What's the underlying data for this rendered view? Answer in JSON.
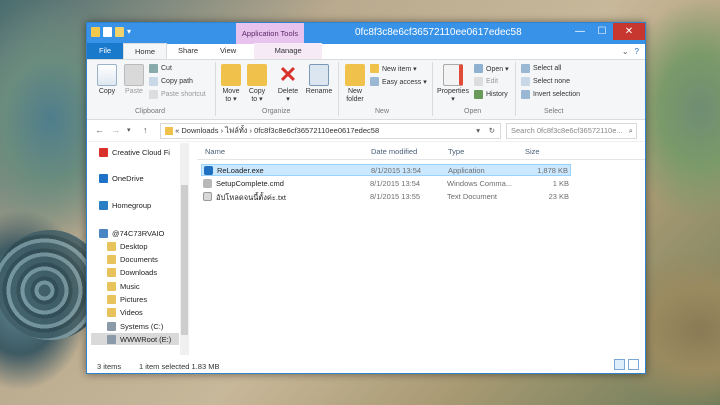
{
  "window": {
    "title": "0fc8f3c8e6cf36572110ee0617edec58",
    "context_tab": "Application Tools",
    "controls": {
      "minimize": "—",
      "maximize": "☐",
      "close": "✕"
    }
  },
  "tabs": {
    "file": "File",
    "home": "Home",
    "share": "Share",
    "view": "View",
    "manage": "Manage",
    "collapse": "⌄",
    "help": "?"
  },
  "ribbon": {
    "clipboard": {
      "copy": "Copy",
      "paste": "Paste",
      "cut": "Cut",
      "copy_path": "Copy path",
      "paste_shortcut": "Paste shortcut",
      "group": "Clipboard"
    },
    "organize": {
      "move_to_1": "Move",
      "move_to_2": "to ▾",
      "copy_to_1": "Copy",
      "copy_to_2": "to ▾",
      "delete_1": "Delete",
      "delete_2": "▾",
      "rename": "Rename",
      "group": "Organize"
    },
    "new": {
      "new_folder_1": "New",
      "new_folder_2": "folder",
      "new_item": "New item ▾",
      "easy_access": "Easy access ▾",
      "group": "New"
    },
    "open": {
      "properties_1": "Properties",
      "properties_2": "▾",
      "open": "Open ▾",
      "edit": "Edit",
      "history": "History",
      "group": "Open"
    },
    "select": {
      "select_all": "Select all",
      "select_none": "Select none",
      "invert_selection": "Invert selection",
      "group": "Select"
    }
  },
  "address": {
    "back": "←",
    "forward": "→",
    "dropdown": "▾",
    "up": "↑",
    "path_prefix": "«",
    "crumbs": [
      "Downloads",
      "ไฟล์ทั้ง",
      "0fc8f3c8e6cf36572110ee0617edec58"
    ],
    "separator": "›",
    "refresh": "↻",
    "search_placeholder": "Search 0fc8f3c8e6cf36572110e...",
    "search_icon": "⌕"
  },
  "nav_pane": {
    "items": [
      {
        "label": "Creative Cloud Fi",
        "icon": "creative-cloud-icon",
        "color": "#d9302a"
      },
      {
        "label": "OneDrive",
        "icon": "onedrive-icon",
        "color": "#1e73c8"
      },
      {
        "label": "Homegroup",
        "icon": "homegroup-icon",
        "color": "#2a7fc4"
      },
      {
        "label": "@74C73RVAIO",
        "icon": "computer-icon",
        "color": "#4a86c4"
      },
      {
        "label": "Desktop",
        "icon": "folder-icon",
        "color": "#e8c25a"
      },
      {
        "label": "Documents",
        "icon": "documents-icon",
        "color": "#e8c25a"
      },
      {
        "label": "Downloads",
        "icon": "downloads-icon",
        "color": "#e8c25a"
      },
      {
        "label": "Music",
        "icon": "music-icon",
        "color": "#e8c25a"
      },
      {
        "label": "Pictures",
        "icon": "pictures-icon",
        "color": "#e8c25a"
      },
      {
        "label": "Videos",
        "icon": "videos-icon",
        "color": "#e8c25a"
      },
      {
        "label": "Systems (C:)",
        "icon": "drive-icon",
        "color": "#8a9aa8"
      },
      {
        "label": "WWWRoot (E:)",
        "icon": "drive-icon",
        "color": "#8a9aa8"
      }
    ]
  },
  "columns": {
    "name": "Name",
    "date": "Date modified",
    "type": "Type",
    "size": "Size"
  },
  "files": [
    {
      "name": "ReLoader.exe",
      "date": "8/1/2015 13:54",
      "type": "Application",
      "size": "1,878 KB",
      "icon": "application-icon",
      "color": "#1f6fc2",
      "selected": true
    },
    {
      "name": "SetupComplete.cmd",
      "date": "8/1/2015 13:54",
      "type": "Windows Comma...",
      "size": "1 KB",
      "icon": "cmd-file-icon",
      "color": "#b8b8b8",
      "selected": false
    },
    {
      "name": "อัปโหลดจนนี้ตั้งค่ะ.txt",
      "date": "8/1/2015 13:55",
      "type": "Text Document",
      "size": "23 KB",
      "icon": "text-file-icon",
      "color": "#d8d8d8",
      "selected": false
    }
  ],
  "status": {
    "items": "3 items",
    "selected": "1 item selected  1.83 MB"
  }
}
